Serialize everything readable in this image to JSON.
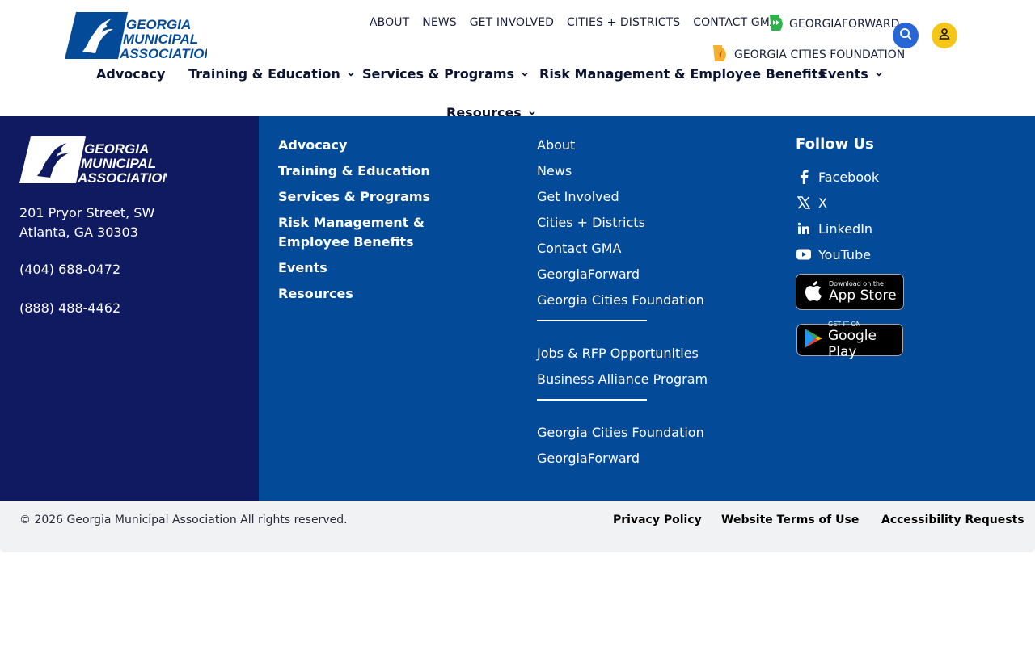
{
  "header": {
    "logo_text": [
      "GEORGIA",
      "MUNICIPAL",
      "ASSOCIATION"
    ],
    "utility_nav": [
      "ABOUT",
      "NEWS",
      "GET INVOLVED",
      "CITIES + DISTRICTS",
      "CONTACT GMA"
    ],
    "georgiaforward_label": "GEORGIAFORWARD",
    "gcf_label": "GEORGIA CITIES FOUNDATION",
    "search_icon": "search-icon",
    "user_icon": "user-icon"
  },
  "main_nav": {
    "advocacy": "Advocacy",
    "training": "Training & Education",
    "services": "Services & Programs",
    "risk": "Risk Management & Employee Benefits",
    "events": "Events",
    "resources": "Resources"
  },
  "footer": {
    "address_line1": "201 Pryor Street, SW",
    "address_line2": "Atlanta, GA 30303",
    "phone1": "(404) 688-0472",
    "phone2": "(888) 488-4462",
    "col1": [
      "Advocacy",
      "Training & Education",
      "Services & Programs",
      "Risk Management & Employee Benefits",
      "Events",
      "Resources"
    ],
    "col2_group1": [
      "About",
      "News",
      "Get Involved",
      "Cities + Districts",
      "Contact GMA",
      "GeorgiaForward",
      "Georgia Cities Foundation"
    ],
    "col2_group2": [
      "Jobs & RFP Opportunities",
      "Business Alliance Program"
    ],
    "col2_group3": [
      "Georgia Cities Foundation",
      "GeorgiaForward"
    ],
    "follow_heading": "Follow Us",
    "social": {
      "facebook": "Facebook",
      "x": "X",
      "linkedin": "LinkedIn",
      "youtube": "YouTube"
    },
    "appstore_small": "Download on the",
    "appstore_big": "App Store",
    "gplay_small": "GET IT ON",
    "gplay_big": "Google Play"
  },
  "bottom": {
    "copyright": "© 2026 Georgia Municipal Association All rights reserved.",
    "privacy": "Privacy Policy",
    "terms": "Website Terms of Use",
    "accessibility": "Accessibility Requests"
  },
  "colors": {
    "navy": "#101a60",
    "blue": "#034b99",
    "search": "#2766d6",
    "user": "#f5c518"
  }
}
